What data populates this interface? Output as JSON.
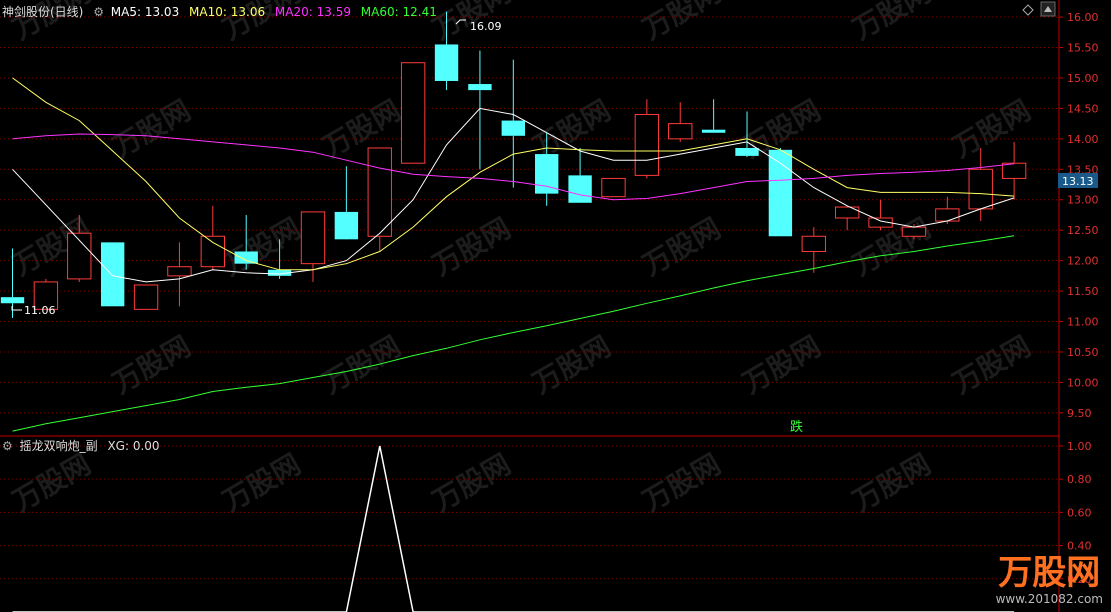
{
  "main_header": {
    "stock": "神剑股份(日线)",
    "ma5": "MA5: 13.03",
    "ma10": "MA10: 13.06",
    "ma20": "MA20: 13.59",
    "ma60": "MA60: 12.41"
  },
  "sub_header": {
    "indicator": "摇龙双响炮_副",
    "xg": "XG: 0.00"
  },
  "colors": {
    "up": "#ff3b3b",
    "down": "#54ffff",
    "ma5": "#ffffff",
    "ma10": "#ffff66",
    "ma20": "#ff33ff",
    "ma60": "#33ff33",
    "grid": "#7a0000",
    "axis": "#c00000"
  },
  "annotations": {
    "high_label": "16.09",
    "low_label": "11.06",
    "current_price": "13.13",
    "signal_text": "跌"
  },
  "watermark": {
    "logo": "万股网",
    "url": "www.201082.com"
  },
  "chart_data": [
    {
      "type": "candlestick",
      "title": "神剑股份(日线)",
      "y_ticks": [
        9.5,
        10.0,
        10.5,
        11.0,
        11.5,
        12.0,
        12.5,
        13.0,
        13.5,
        14.0,
        14.5,
        15.0,
        15.5,
        16.0
      ],
      "ylim": [
        9.12,
        16.28
      ],
      "candles": [
        {
          "o": 11.4,
          "h": 12.2,
          "l": 11.06,
          "c": 11.3
        },
        {
          "o": 11.2,
          "h": 11.7,
          "l": 11.2,
          "c": 11.65
        },
        {
          "o": 11.7,
          "h": 12.75,
          "l": 11.65,
          "c": 12.45
        },
        {
          "o": 12.3,
          "h": 12.3,
          "l": 11.25,
          "c": 11.25
        },
        {
          "o": 11.2,
          "h": 11.6,
          "l": 11.2,
          "c": 11.6
        },
        {
          "o": 11.75,
          "h": 12.3,
          "l": 11.25,
          "c": 11.9
        },
        {
          "o": 11.9,
          "h": 12.9,
          "l": 11.85,
          "c": 12.4
        },
        {
          "o": 12.15,
          "h": 12.75,
          "l": 11.85,
          "c": 11.95
        },
        {
          "o": 11.85,
          "h": 12.35,
          "l": 11.7,
          "c": 11.75
        },
        {
          "o": 11.95,
          "h": 12.05,
          "l": 11.65,
          "c": 12.8
        },
        {
          "o": 12.8,
          "h": 13.55,
          "l": 12.75,
          "c": 12.35
        },
        {
          "o": 12.4,
          "h": 13.85,
          "l": 12.15,
          "c": 13.85
        },
        {
          "o": 13.6,
          "h": 15.25,
          "l": 13.6,
          "c": 15.25
        },
        {
          "o": 15.55,
          "h": 16.09,
          "l": 14.8,
          "c": 14.95
        },
        {
          "o": 14.9,
          "h": 15.45,
          "l": 13.5,
          "c": 14.8
        },
        {
          "o": 14.3,
          "h": 15.3,
          "l": 13.2,
          "c": 14.05
        },
        {
          "o": 13.75,
          "h": 14.1,
          "l": 12.9,
          "c": 13.1
        },
        {
          "o": 13.4,
          "h": 13.85,
          "l": 12.95,
          "c": 12.95
        },
        {
          "o": 13.05,
          "h": 13.35,
          "l": 13.05,
          "c": 13.35
        },
        {
          "o": 13.4,
          "h": 14.65,
          "l": 13.35,
          "c": 14.4
        },
        {
          "o": 14.0,
          "h": 14.6,
          "l": 13.95,
          "c": 14.25
        },
        {
          "o": 14.15,
          "h": 14.65,
          "l": 14.1,
          "c": 14.1
        },
        {
          "o": 13.85,
          "h": 14.45,
          "l": 13.7,
          "c": 13.72
        },
        {
          "o": 13.82,
          "h": 13.85,
          "l": 12.4,
          "c": 12.4
        },
        {
          "o": 12.15,
          "h": 12.55,
          "l": 11.8,
          "c": 12.4
        },
        {
          "o": 12.7,
          "h": 12.9,
          "l": 12.5,
          "c": 12.88
        },
        {
          "o": 12.55,
          "h": 13.0,
          "l": 12.5,
          "c": 12.7
        },
        {
          "o": 12.4,
          "h": 12.6,
          "l": 12.35,
          "c": 12.55
        },
        {
          "o": 12.65,
          "h": 13.05,
          "l": 12.6,
          "c": 12.85
        },
        {
          "o": 12.85,
          "h": 13.85,
          "l": 12.65,
          "c": 13.5
        },
        {
          "o": 13.35,
          "h": 13.95,
          "l": 13.0,
          "c": 13.6
        }
      ],
      "series": [
        {
          "name": "MA5",
          "values": [
            13.5,
            null,
            null,
            11.75,
            11.65,
            11.7,
            11.85,
            11.8,
            11.78,
            11.85,
            12.0,
            12.45,
            13.0,
            13.9,
            14.5,
            14.4,
            14.1,
            13.8,
            13.65,
            13.65,
            13.75,
            13.85,
            13.95,
            13.6,
            13.2,
            12.9,
            12.65,
            12.55,
            12.65,
            12.85,
            13.03
          ]
        },
        {
          "name": "MA10",
          "values": [
            15.0,
            14.6,
            14.3,
            13.8,
            13.3,
            12.7,
            12.3,
            12.0,
            11.85,
            11.85,
            11.95,
            12.15,
            12.55,
            13.05,
            13.45,
            13.75,
            13.85,
            13.82,
            13.8,
            13.8,
            13.8,
            13.9,
            14.0,
            13.82,
            13.5,
            13.2,
            13.12,
            13.12,
            13.12,
            13.1,
            13.06
          ]
        },
        {
          "name": "MA20",
          "values": [
            14.0,
            14.05,
            14.08,
            14.07,
            14.05,
            14.0,
            13.95,
            13.9,
            13.85,
            13.78,
            13.65,
            13.52,
            13.42,
            13.38,
            13.35,
            13.3,
            13.22,
            13.08,
            13.0,
            13.02,
            13.1,
            13.2,
            13.3,
            13.32,
            13.35,
            13.4,
            13.43,
            13.45,
            13.48,
            13.53,
            13.59
          ]
        },
        {
          "name": "MA60",
          "values": [
            9.2,
            9.32,
            9.42,
            9.52,
            9.62,
            9.72,
            9.85,
            9.92,
            9.98,
            10.08,
            10.18,
            10.3,
            10.44,
            10.56,
            10.7,
            10.82,
            10.93,
            11.05,
            11.17,
            11.3,
            11.42,
            11.55,
            11.67,
            11.77,
            11.87,
            11.98,
            12.08,
            12.15,
            12.24,
            12.32,
            12.41
          ]
        }
      ]
    },
    {
      "type": "line",
      "title": "摇龙双响炮_副",
      "y_ticks": [
        0.2,
        0.4,
        0.6,
        0.8,
        1.0
      ],
      "ylim": [
        0,
        1.06
      ],
      "series": [
        {
          "name": "XG",
          "values": [
            0,
            0,
            0,
            0,
            0,
            0,
            0,
            0,
            0,
            0,
            0,
            1,
            0,
            0,
            0,
            0,
            0,
            0,
            0,
            0,
            0,
            0,
            0,
            0,
            0,
            0,
            0,
            0,
            0,
            0,
            0
          ]
        }
      ]
    }
  ]
}
